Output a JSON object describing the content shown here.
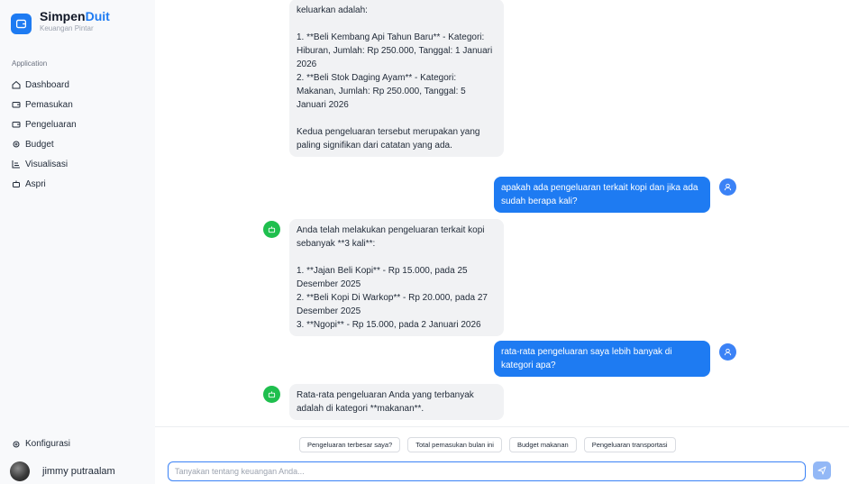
{
  "brand": {
    "name_part1": "Simpen",
    "name_part2": "Duit",
    "subtitle": "Keuangan Pintar",
    "accent_color": "#1e7bf2"
  },
  "sidebar": {
    "section_label": "Application",
    "items": [
      {
        "label": "Dashboard",
        "icon": "home-icon"
      },
      {
        "label": "Pemasukan",
        "icon": "wallet-icon"
      },
      {
        "label": "Pengeluaran",
        "icon": "wallet-icon"
      },
      {
        "label": "Budget",
        "icon": "gear-icon"
      },
      {
        "label": "Visualisasi",
        "icon": "chart-icon"
      },
      {
        "label": "Aspri",
        "icon": "bot-icon"
      }
    ],
    "config_label": "Konfigurasi",
    "user_name": "jimmy putraalam"
  },
  "chat": {
    "messages": [
      {
        "role": "assistant",
        "text": "keluarkan adalah:\n\n1. **Beli Kembang Api Tahun Baru** - Kategori: Hiburan, Jumlah: Rp 250.000, Tanggal: 1 Januari 2026\n2. **Beli Stok Daging Ayam** - Kategori: Makanan, Jumlah: Rp 250.000, Tanggal: 5 Januari 2026\n\nKedua pengeluaran tersebut merupakan yang paling signifikan dari catatan yang ada."
      },
      {
        "role": "user",
        "text": "apakah ada pengeluaran terkait kopi dan jika ada sudah berapa kali?"
      },
      {
        "role": "assistant",
        "text": "Anda telah melakukan pengeluaran terkait kopi sebanyak **3 kali**:\n\n1. **Jajan Beli Kopi** - Rp 15.000, pada 25 Desember 2025\n2. **Beli Kopi Di Warkop** - Rp 20.000, pada 27 Desember 2025\n3. **Ngopi** - Rp 15.000, pada 2 Januari 2026"
      },
      {
        "role": "user",
        "text": "rata-rata pengeluaran saya lebih banyak di kategori apa?"
      },
      {
        "role": "assistant",
        "text": "Rata-rata pengeluaran Anda yang terbanyak adalah di kategori **makanan**."
      }
    ],
    "suggestions": [
      "Pengeluaran terbesar saya?",
      "Total pemasukan bulan ini",
      "Budget makanan",
      "Pengeluaran transportasi"
    ],
    "input_placeholder": "Tanyakan tentang keuangan Anda...",
    "input_value": ""
  }
}
